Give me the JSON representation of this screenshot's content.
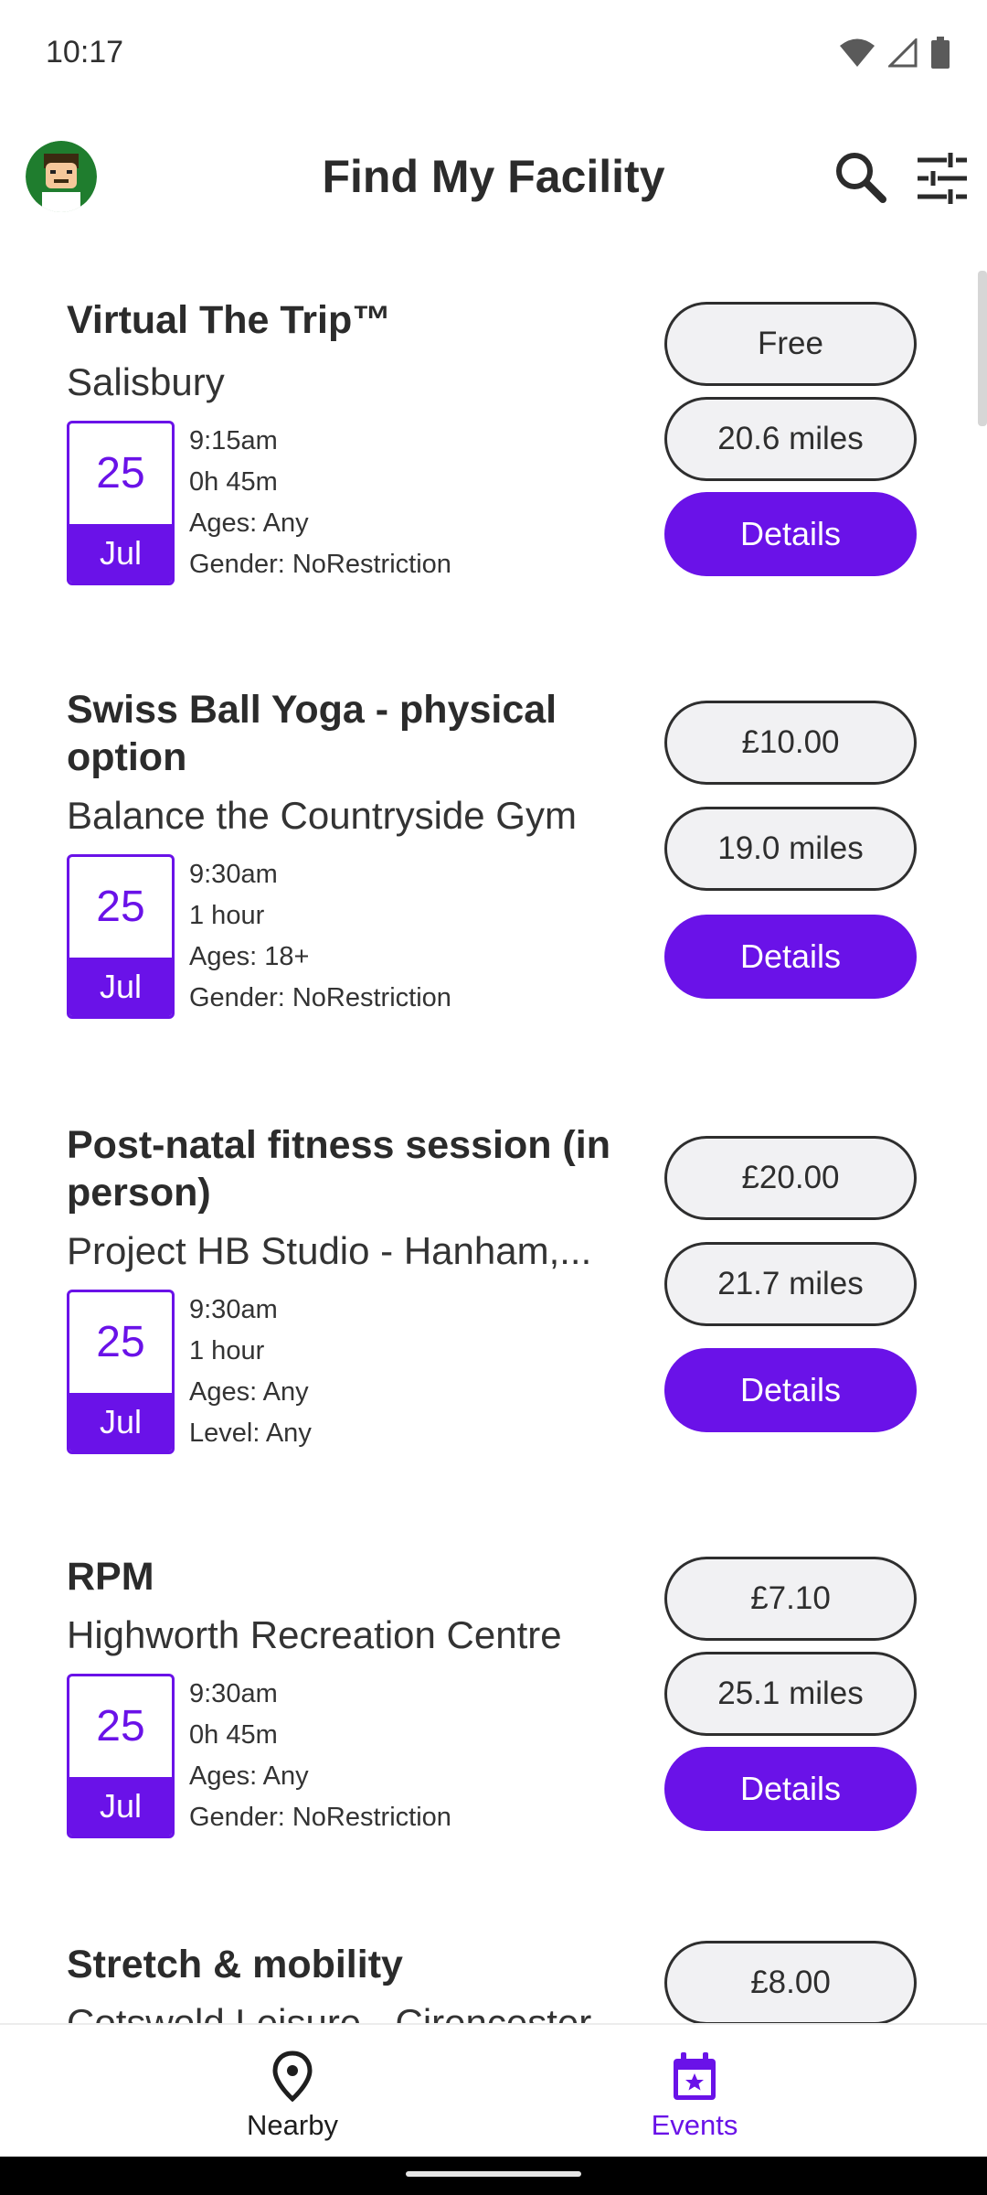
{
  "status_bar": {
    "time": "10:17"
  },
  "app_bar": {
    "title": "Find My Facility"
  },
  "events": [
    {
      "title": "Virtual The Trip™",
      "venue": "Salisbury",
      "day": "25",
      "month": "Jul",
      "details": [
        "9:15am",
        "0h 45m",
        "Ages: Any",
        "Gender:  NoRestriction"
      ],
      "price": "Free",
      "distance": "20.6 miles",
      "action": "Details"
    },
    {
      "title": "Swiss Ball Yoga - physical option",
      "venue": "Balance the Countryside Gym",
      "day": "25",
      "month": "Jul",
      "details": [
        "9:30am",
        "1 hour",
        "Ages: 18+",
        "Gender:  NoRestriction"
      ],
      "price": "£10.00",
      "distance": "19.0 miles",
      "action": "Details"
    },
    {
      "title": "Post-natal fitness session (in person)",
      "venue": "Project HB Studio - Hanham,...",
      "day": "25",
      "month": "Jul",
      "details": [
        "9:30am",
        "1 hour",
        "Ages: Any",
        "Level: Any"
      ],
      "price": "£20.00",
      "distance": "21.7 miles",
      "action": "Details"
    },
    {
      "title": "RPM",
      "venue": "Highworth Recreation Centre",
      "day": "25",
      "month": "Jul",
      "details": [
        "9:30am",
        "0h 45m",
        "Ages: Any",
        "Gender:  NoRestriction"
      ],
      "price": "£7.10",
      "distance": "25.1 miles",
      "action": "Details"
    },
    {
      "title": "Stretch & mobility",
      "venue": "Cotswold Leisure - Cirencester",
      "price": "£8.00"
    }
  ],
  "bottom_nav": {
    "items": [
      {
        "label": "Nearby",
        "icon": "location-pin-icon",
        "active": false
      },
      {
        "label": "Events",
        "icon": "calendar-star-icon",
        "active": true
      }
    ]
  },
  "colors": {
    "accent": "#6a12e8",
    "text": "#2b2b2b",
    "pill_bg": "#f1f1f3"
  }
}
